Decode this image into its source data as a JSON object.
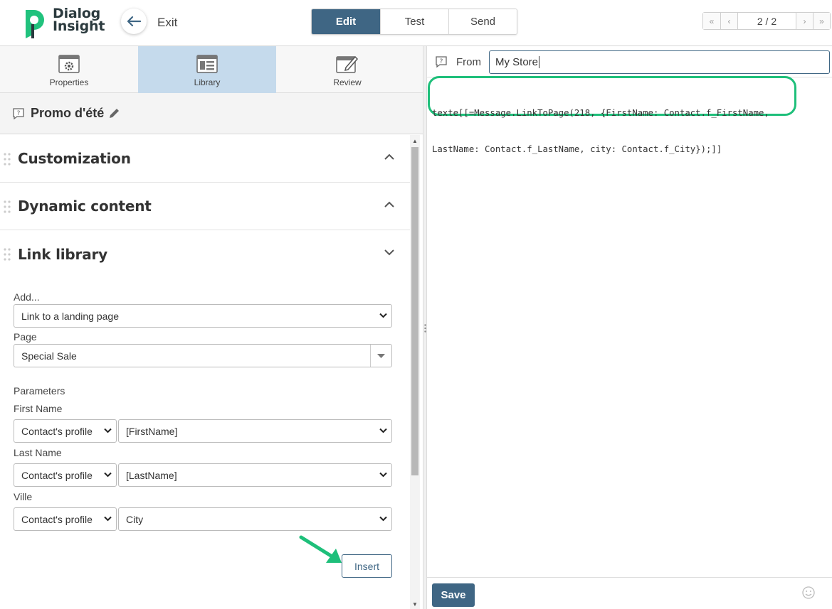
{
  "brand": {
    "line1": "Dialog",
    "line2": "Insight",
    "accent": "#21c27d",
    "dark": "#2b3a3e"
  },
  "header": {
    "exit_label": "Exit",
    "modes": [
      {
        "label": "Edit",
        "active": true
      },
      {
        "label": "Test",
        "active": false
      },
      {
        "label": "Send",
        "active": false
      }
    ],
    "pager": {
      "text": "2 / 2",
      "first": "«",
      "prev": "‹",
      "next": "›",
      "last": "»"
    }
  },
  "left_tabs": [
    {
      "label": "Properties",
      "icon": "gear-window-icon",
      "active": false
    },
    {
      "label": "Library",
      "icon": "library-window-icon",
      "active": true
    },
    {
      "label": "Review",
      "icon": "edit-window-icon",
      "active": false
    }
  ],
  "message": {
    "title": "Promo d'été"
  },
  "sections": [
    {
      "title": "Customization",
      "state": "collapsed"
    },
    {
      "title": "Dynamic content",
      "state": "collapsed"
    },
    {
      "title": "Link library",
      "state": "expanded"
    }
  ],
  "link_form": {
    "add_label": "Add...",
    "add_value": "Link to a landing page",
    "page_label": "Page",
    "page_value": "Special Sale",
    "parameters_label": "Parameters",
    "params": [
      {
        "label": "First Name",
        "source": "Contact's profile",
        "field": "[FirstName]"
      },
      {
        "label": "Last Name",
        "source": "Contact's profile",
        "field": "[LastName]"
      },
      {
        "label": "Ville",
        "source": "Contact's profile",
        "field": "City"
      }
    ],
    "insert_label": "Insert"
  },
  "editor": {
    "from_label": "From",
    "from_value": "My Store",
    "code_line1": "texte[[=Message.LinkToPage(218, {FirstName: Contact.f_FirstName,",
    "code_line2": "LastName: Contact.f_LastName, city: Contact.f_City});]]",
    "save_label": "Save"
  },
  "colors": {
    "primary": "#3f6684",
    "highlight": "#1ebf7a",
    "active_tab": "#c5daec"
  }
}
